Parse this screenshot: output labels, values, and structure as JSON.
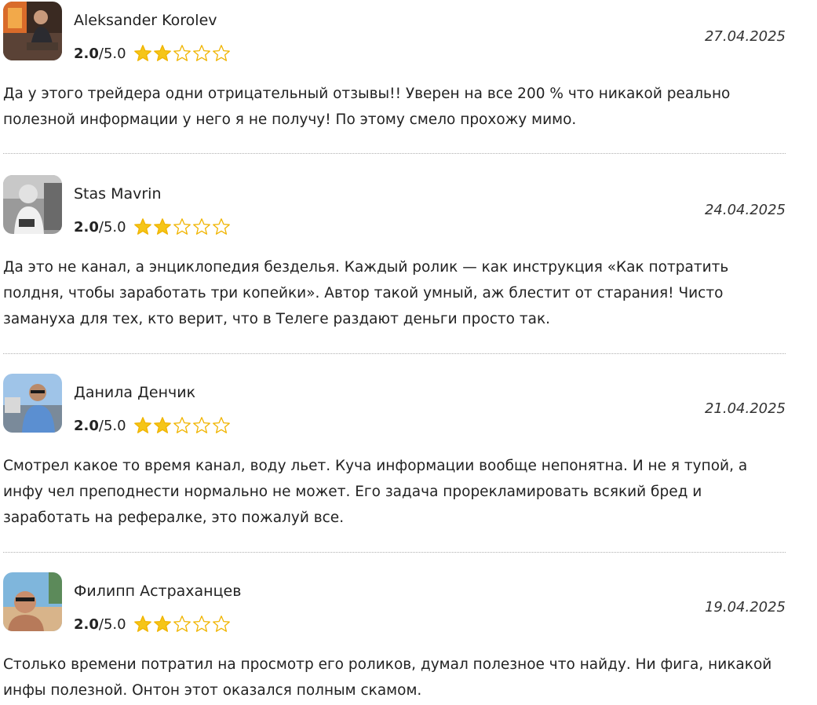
{
  "reviews": [
    {
      "author": "Aleksander Korolev",
      "score": "2.0",
      "max": "/5.0",
      "stars_filled": 2,
      "stars_total": 5,
      "date": "27.04.2025",
      "text": "Да у этого трейдера одни отрицательный отзывы!! Уверен на все 200 % что никакой реально полезной информации у него я не получу! По этому смело прохожу мимо."
    },
    {
      "author": "Stas Mavrin",
      "score": "2.0",
      "max": "/5.0",
      "stars_filled": 2,
      "stars_total": 5,
      "date": "24.04.2025",
      "text": "Да это не канал, а энциклопедия безделья. Каждый ролик — как инструкция «Как потратить полдня, чтобы заработать три копейки». Автор такой умный, аж блестит от старания! Чисто замануха для тех, кто верит, что в Телеге раздают деньги просто так."
    },
    {
      "author": "Данила Денчик",
      "score": "2.0",
      "max": "/5.0",
      "stars_filled": 2,
      "stars_total": 5,
      "date": "21.04.2025",
      "text": "Смотрел какое то время канал, воду льет. Куча информации вообще непонятна. И не я тупой, а инфу чел преподнести нормально не может. Его задача прорекламировать всякий бред и заработать на рефералке, это пожалуй все."
    },
    {
      "author": "Филипп Астраханцев",
      "score": "2.0",
      "max": "/5.0",
      "stars_filled": 2,
      "stars_total": 5,
      "date": "19.04.2025",
      "text": "Столько времени потратил на просмотр его роликов, думал полезное что найду. Ни фига, никакой инфы полезной. Онтон этот оказался полным скамом."
    }
  ],
  "colors": {
    "star_fill": "#f5c518",
    "star_stroke": "#f0b400",
    "divider": "#b0b0b0",
    "text": "#222222"
  },
  "icons": {
    "star_full": "star-filled-icon",
    "star_empty": "star-outline-icon"
  }
}
